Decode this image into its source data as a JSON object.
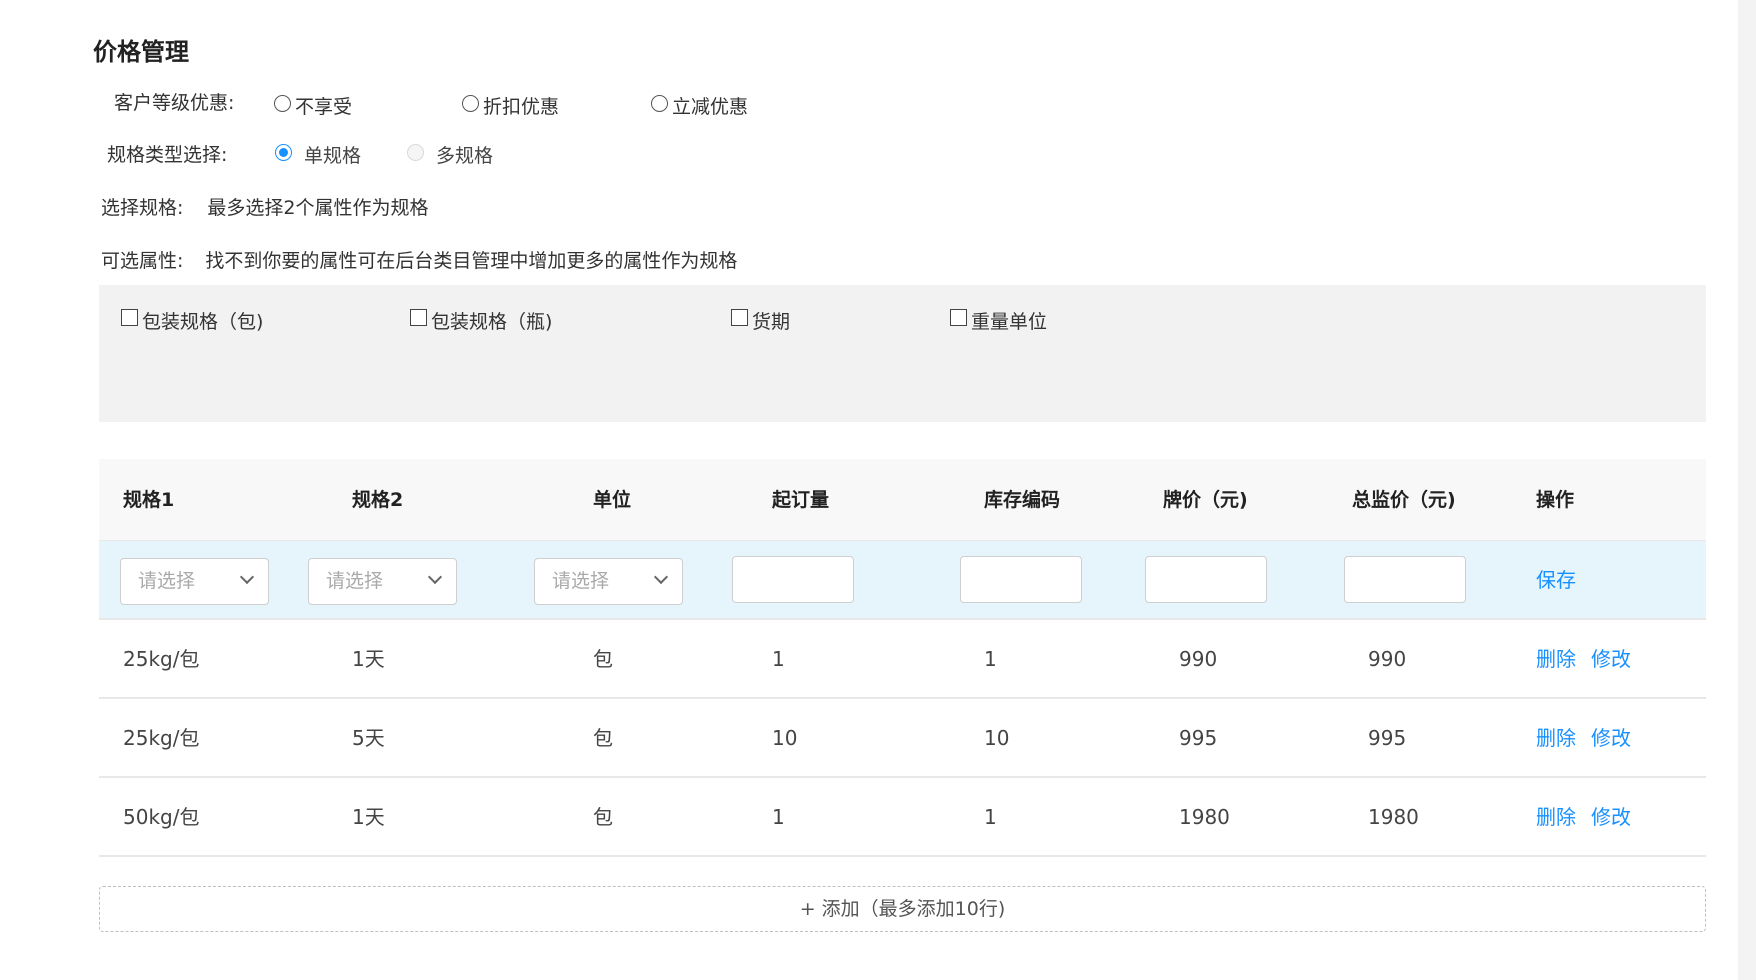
{
  "page_title": "价格管理",
  "customer_level": {
    "label": "客户等级优惠:",
    "options": [
      "不享受",
      "折扣优惠",
      "立减优惠"
    ]
  },
  "spec_type": {
    "label": "规格类型选择:",
    "options": [
      "单规格",
      "多规格"
    ],
    "selected": "单规格"
  },
  "select_spec": {
    "label": "选择规格:",
    "hint": "最多选择2个属性作为规格"
  },
  "optional_attrs": {
    "label": "可选属性:",
    "hint": "找不到你要的属性可在后台类目管理中增加更多的属性作为规格",
    "items": [
      "包装规格（包)",
      "包装规格（瓶)",
      "货期",
      "重量单位"
    ]
  },
  "table": {
    "headers": [
      "规格1",
      "规格2",
      "单位",
      "起订量",
      "库存编码",
      "牌价（元)",
      "总监价（元)",
      "操作"
    ],
    "select_placeholder": "请选择",
    "save_label": "保存",
    "rows": [
      [
        "25kg/包",
        "1天",
        "包",
        "1",
        "1",
        "990",
        "990"
      ],
      [
        "25kg/包",
        "5天",
        "包",
        "10",
        "10",
        "995",
        "995"
      ],
      [
        "50kg/包",
        "1天",
        "包",
        "1",
        "1",
        "1980",
        "1980"
      ]
    ],
    "delete_label": "删除",
    "edit_label": "修改"
  },
  "add_button": "+ 添加（最多添加10行)"
}
